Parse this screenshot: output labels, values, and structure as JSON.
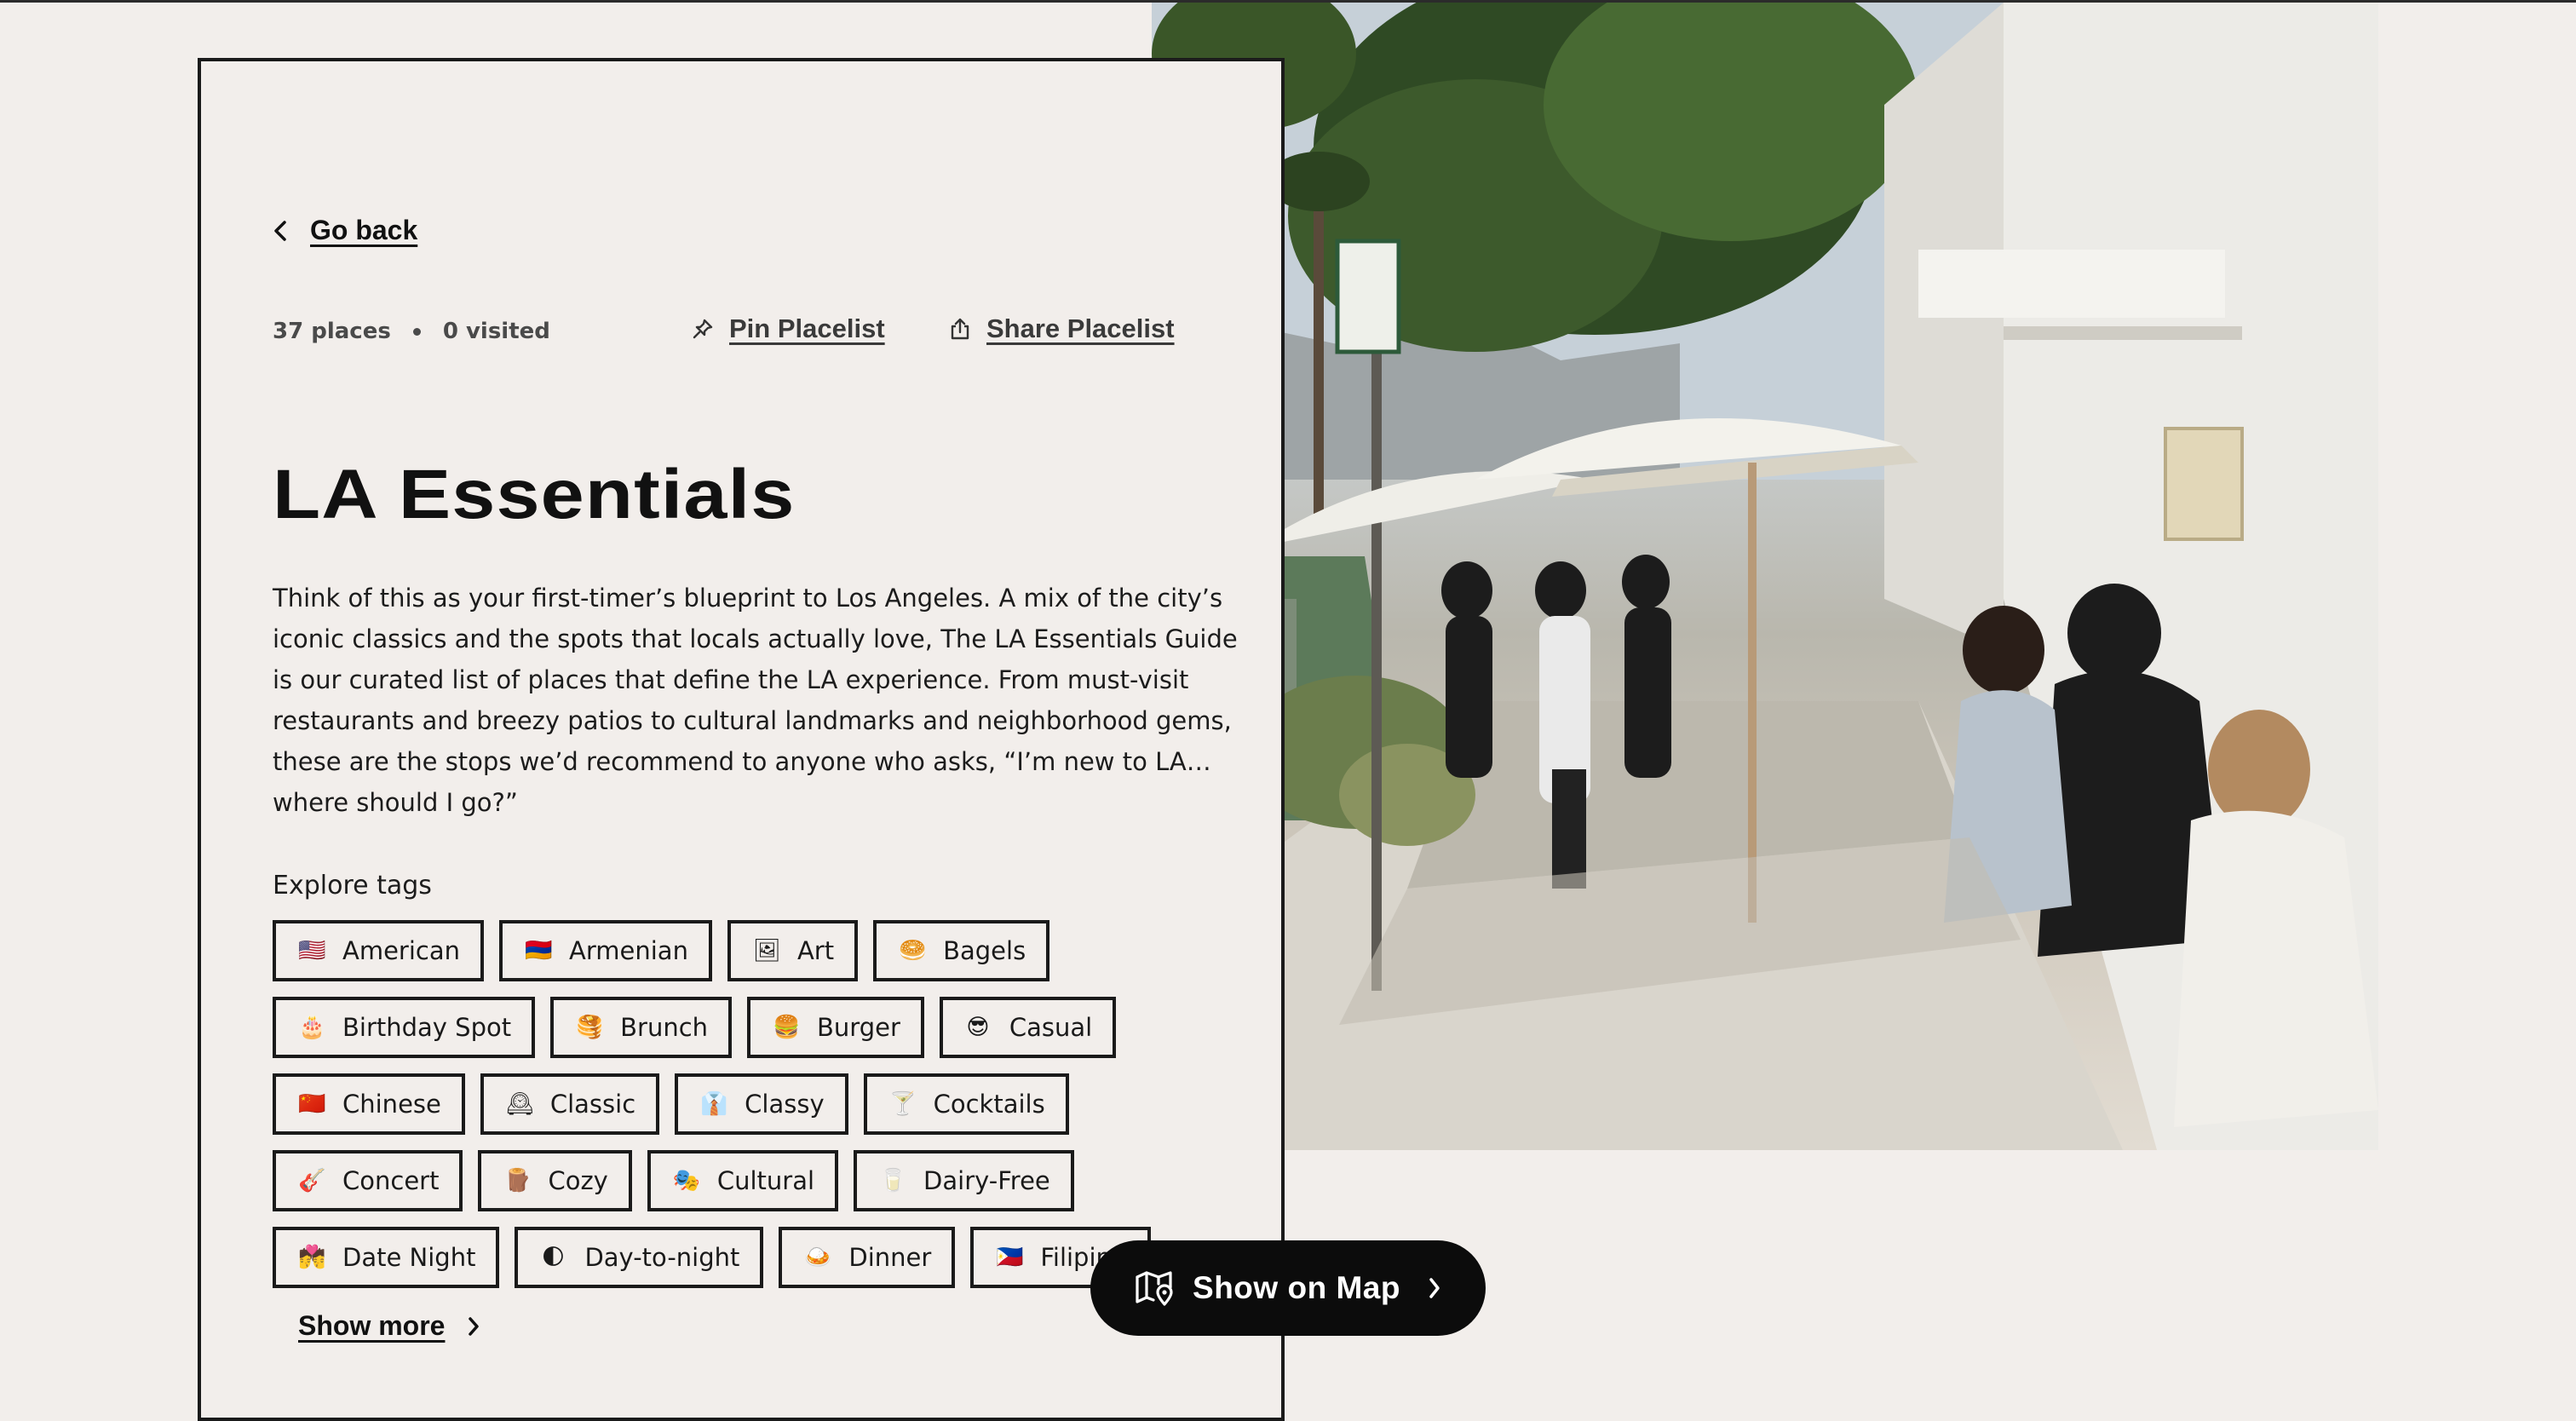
{
  "nav": {
    "back_label": "Go back"
  },
  "placelist": {
    "places_count": "37 places",
    "visited_count": "0 visited",
    "pin_label": "Pin Placelist",
    "share_label": "Share Placelist",
    "title": "LA Essentials",
    "description": "Think of this as your first-timer’s blueprint to Los Angeles. A mix of the city’s iconic classics and the spots that locals actually love, The LA Essentials Guide is our curated list of places that define the LA experience. From must-visit restaurants and breezy patios to cultural landmarks and neighborhood gems, these are the stops we’d recommend to anyone who asks, “I’m new to LA…where should I go?”"
  },
  "tags": {
    "label": "Explore tags",
    "items": [
      {
        "emoji": "🇺🇸",
        "label": "American"
      },
      {
        "emoji": "🇦🇲",
        "label": "Armenian"
      },
      {
        "emoji": "🖼",
        "label": "Art"
      },
      {
        "emoji": "🥯",
        "label": "Bagels"
      },
      {
        "emoji": "🎂",
        "label": "Birthday Spot"
      },
      {
        "emoji": "🥞",
        "label": "Brunch"
      },
      {
        "emoji": "🍔",
        "label": "Burger"
      },
      {
        "emoji": "😎",
        "label": "Casual"
      },
      {
        "emoji": "🇨🇳",
        "label": "Chinese"
      },
      {
        "emoji": "🕰",
        "label": "Classic"
      },
      {
        "emoji": "👔",
        "label": "Classy"
      },
      {
        "emoji": "🍸",
        "label": "Cocktails"
      },
      {
        "emoji": "🎸",
        "label": "Concert"
      },
      {
        "emoji": "🪵",
        "label": "Cozy"
      },
      {
        "emoji": "🎭",
        "label": "Cultural"
      },
      {
        "emoji": "🥛",
        "label": "Dairy-Free"
      },
      {
        "emoji": "💏",
        "label": "Date Night"
      },
      {
        "emoji": "🌓",
        "label": "Day-to-night"
      },
      {
        "emoji": "🍛",
        "label": "Dinner"
      },
      {
        "emoji": "🇵🇭",
        "label": "Filipino"
      }
    ],
    "show_more_label": "Show more"
  },
  "map_button": {
    "label": "Show on Map"
  },
  "icons": {
    "back": "chevron-left-icon",
    "pin": "pin-icon",
    "share": "share-icon",
    "show_more": "chevron-right-icon",
    "map": "map-pin-icon"
  },
  "colors": {
    "background": "#f2eeeb",
    "ink": "#111111",
    "button": "#0c0c0c"
  }
}
